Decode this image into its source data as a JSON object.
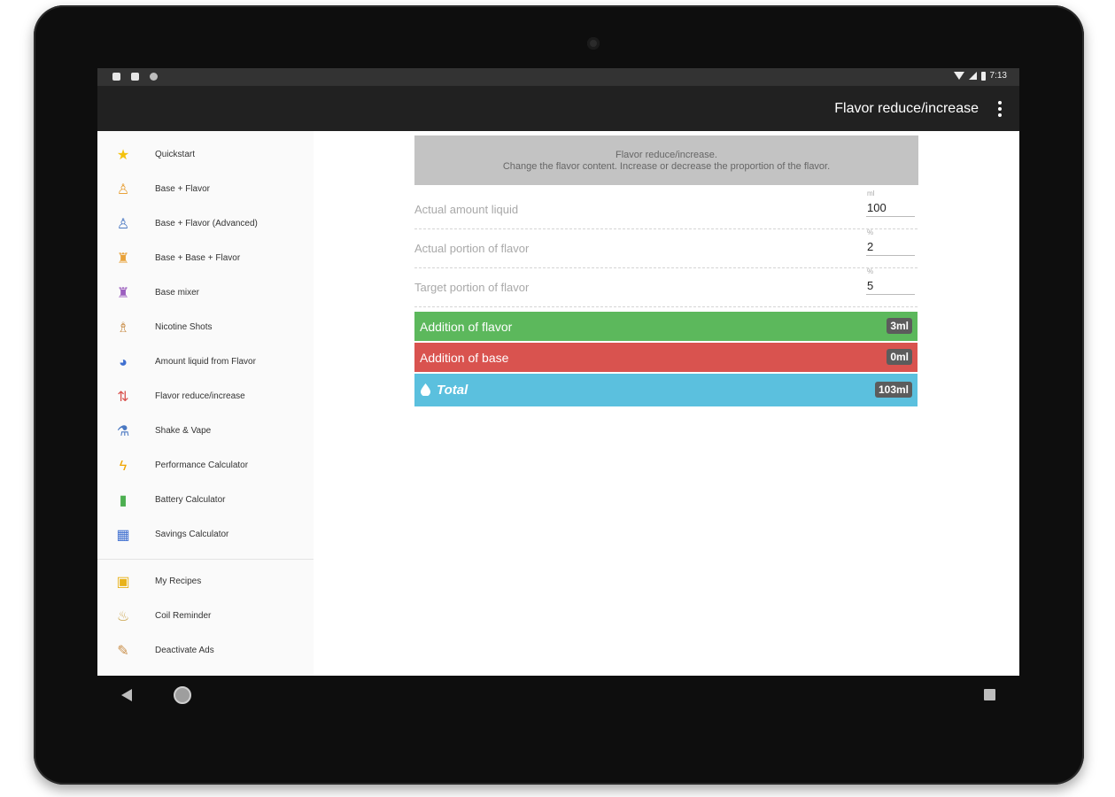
{
  "status_bar": {
    "time": "7:13"
  },
  "app_bar": {
    "title": "Flavor reduce/increase"
  },
  "drawer": {
    "items": [
      {
        "label": "Quickstart",
        "icon": "star-icon",
        "glyph": "★",
        "color": "#f4c20d"
      },
      {
        "label": "Base + Flavor",
        "icon": "bottle-icon",
        "glyph": "♙",
        "color": "#e8a23a"
      },
      {
        "label": "Base + Flavor (Advanced)",
        "icon": "bottle-advanced-icon",
        "glyph": "♙",
        "color": "#4a78c2"
      },
      {
        "label": "Base + Base + Flavor",
        "icon": "bottles-icon",
        "glyph": "♜",
        "color": "#e8a23a"
      },
      {
        "label": "Base mixer",
        "icon": "base-mixer-icon",
        "glyph": "♜",
        "color": "#9c5fbf"
      },
      {
        "label": "Nicotine Shots",
        "icon": "nicotine-shot-icon",
        "glyph": "♗",
        "color": "#c98f4a"
      },
      {
        "label": "Amount liquid from Flavor",
        "icon": "pie-chart-icon",
        "glyph": "◕",
        "color": "#3f6fd0"
      },
      {
        "label": "Flavor reduce/increase",
        "icon": "reduce-increase-icon",
        "glyph": "⇅",
        "color": "#d9534f"
      },
      {
        "label": "Shake & Vape",
        "icon": "shake-vape-icon",
        "glyph": "⚗",
        "color": "#4a78c2"
      },
      {
        "label": "Performance Calculator",
        "icon": "lightning-icon",
        "glyph": "ϟ",
        "color": "#f0a500"
      },
      {
        "label": "Battery Calculator",
        "icon": "battery-icon",
        "glyph": "▮",
        "color": "#4caf50"
      },
      {
        "label": "Savings Calculator",
        "icon": "savings-icon",
        "glyph": "▦",
        "color": "#3f6fd0"
      }
    ],
    "secondary_items": [
      {
        "label": "My Recipes",
        "icon": "recipes-icon",
        "glyph": "▣",
        "color": "#e8b21a"
      },
      {
        "label": "Coil Reminder",
        "icon": "coil-reminder-icon",
        "glyph": "♨",
        "color": "#c9a24a"
      },
      {
        "label": "Deactivate Ads",
        "icon": "megaphone-icon",
        "glyph": "✎",
        "color": "#c98f4a"
      }
    ]
  },
  "content": {
    "header_line1": "Flavor reduce/increase.",
    "header_line2": "Change the flavor content. Increase or decrease the proportion of the flavor.",
    "fields": [
      {
        "label": "Actual amount liquid",
        "unit": "ml",
        "value": "100"
      },
      {
        "label": "Actual portion of flavor",
        "unit": "%",
        "value": "2"
      },
      {
        "label": "Target portion of flavor",
        "unit": "%",
        "value": "5"
      }
    ],
    "results": [
      {
        "label": "Addition of flavor",
        "value": "3ml",
        "color": "#5cb85c"
      },
      {
        "label": "Addition of base",
        "value": "0ml",
        "color": "#d9534f"
      },
      {
        "label": "Total",
        "value": "103ml",
        "color": "#5bc0de",
        "icon": "drop-icon"
      }
    ]
  }
}
